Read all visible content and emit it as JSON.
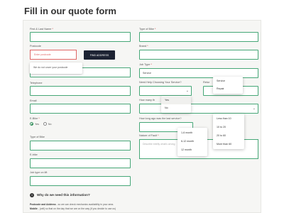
{
  "page": {
    "title": "Fill in our quote form"
  },
  "left": {
    "name_label": "First & Last Name",
    "postcode_label": "Postcode",
    "postcode_placeholder": "Enter postcode",
    "find_button": "FIND ADDRESS",
    "postcode_tooltip": "We do not cover your postcode",
    "telephone_label": "Telephone",
    "email_label": "Email",
    "ebike_label": "E-Bike",
    "ebike_yes": "Yes",
    "ebike_no": "No",
    "type_of_bike_label": "Type of Bike",
    "ebike_field_label": "E-bike",
    "job_type_label": "Job type on lift"
  },
  "right": {
    "type_of_bike_label": "Type of Bike",
    "brand_label": "Brand",
    "job_type_label": "Job Type",
    "job_type_value": "Service",
    "need_help_label": "Need Help Choosing Your Service?",
    "return_label": "Retur",
    "how_many_label": "How many th",
    "how_long_label": "How long ago was the last service?",
    "nature_label": "Nature of Fault",
    "nature_placeholder": "Describe briefly what's wrong"
  },
  "dropdowns": {
    "service_repair": [
      "Service",
      "Repair"
    ],
    "yes_no": [
      "Yes",
      "No"
    ],
    "months": [
      "1-6 month",
      "6-12 month",
      "12 month"
    ],
    "distance": [
      "Less than 10",
      "10 to 20",
      "20 to 60",
      "More than 60"
    ]
  },
  "info": {
    "title": "Why do we need this information?",
    "postcode_line_label": "Postcode and Address",
    "postcode_line_text": " - so we can check mechanics availability in your area.",
    "mobile_line_label": "Mobile",
    "mobile_line_text": " - (cell) so that on the day that we are on the way (if you decide to use us)"
  }
}
